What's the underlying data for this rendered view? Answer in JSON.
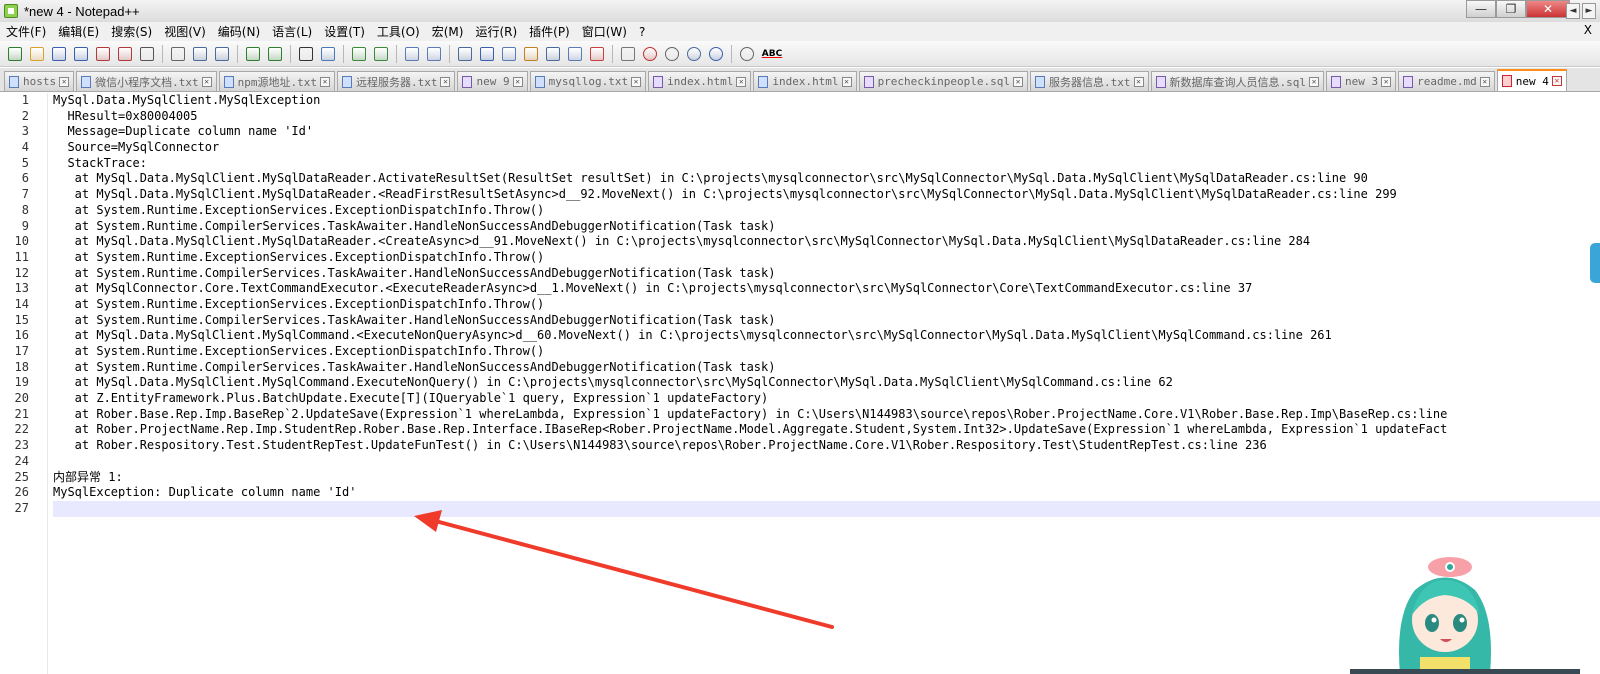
{
  "window": {
    "title": "*new 4 - Notepad++",
    "controls": [
      "—",
      "❐",
      "✕"
    ]
  },
  "menu": {
    "items": [
      "文件(F)",
      "编辑(E)",
      "搜索(S)",
      "视图(V)",
      "编码(N)",
      "语言(L)",
      "设置(T)",
      "工具(O)",
      "宏(M)",
      "运行(R)",
      "插件(P)",
      "窗口(W)",
      "?"
    ],
    "close_label": "X"
  },
  "toolbar": {
    "icons": [
      "new-file-icon",
      "open-file-icon",
      "save-icon",
      "save-all-icon",
      "close-icon",
      "close-all-icon",
      "print-icon",
      "cut-icon",
      "copy-icon",
      "paste-icon",
      "undo-icon",
      "redo-icon",
      "find-icon",
      "replace-icon",
      "zoom-in-icon",
      "zoom-out-icon",
      "sync-vertical-icon",
      "sync-horizontal-icon",
      "word-wrap-icon",
      "show-all-chars-icon",
      "indent-guide-icon",
      "language-icon",
      "doc-map-icon",
      "function-list-icon",
      "folder-workspace-icon",
      "monitor-icon",
      "record-macro-icon",
      "stop-macro-icon",
      "play-macro-icon",
      "run-macro-multiple-icon",
      "save-macro-icon",
      "spell-check-icon"
    ],
    "spell_label": "ABC"
  },
  "tabs": [
    {
      "label": "hosts",
      "color": "blue"
    },
    {
      "label": "微信小程序文档.txt",
      "color": "blue"
    },
    {
      "label": "npm源地址.txt",
      "color": "blue"
    },
    {
      "label": "远程服务器.txt",
      "color": "blue"
    },
    {
      "label": "new 9",
      "color": "purple"
    },
    {
      "label": "mysqllog.txt",
      "color": "blue"
    },
    {
      "label": "index.html",
      "color": "purple"
    },
    {
      "label": "index.html",
      "color": "blue"
    },
    {
      "label": "precheckinpeople.sql",
      "color": "purple"
    },
    {
      "label": "服务器信息.txt",
      "color": "blue"
    },
    {
      "label": "新数据库查询人员信息.sql",
      "color": "purple"
    },
    {
      "label": "new 3",
      "color": "purple"
    },
    {
      "label": "readme.md",
      "color": "purple"
    },
    {
      "label": "new 4",
      "color": "red",
      "active": true
    }
  ],
  "tab_nav": [
    "◄",
    "►"
  ],
  "editor": {
    "lines": [
      "MySql.Data.MySqlClient.MySqlException",
      "  HResult=0x80004005",
      "  Message=Duplicate column name 'Id'",
      "  Source=MySqlConnector",
      "  StackTrace:",
      "   at MySql.Data.MySqlClient.MySqlDataReader.ActivateResultSet(ResultSet resultSet) in C:\\projects\\mysqlconnector\\src\\MySqlConnector\\MySql.Data.MySqlClient\\MySqlDataReader.cs:line 90",
      "   at MySql.Data.MySqlClient.MySqlDataReader.<ReadFirstResultSetAsync>d__92.MoveNext() in C:\\projects\\mysqlconnector\\src\\MySqlConnector\\MySql.Data.MySqlClient\\MySqlDataReader.cs:line 299",
      "   at System.Runtime.ExceptionServices.ExceptionDispatchInfo.Throw()",
      "   at System.Runtime.CompilerServices.TaskAwaiter.HandleNonSuccessAndDebuggerNotification(Task task)",
      "   at MySql.Data.MySqlClient.MySqlDataReader.<CreateAsync>d__91.MoveNext() in C:\\projects\\mysqlconnector\\src\\MySqlConnector\\MySql.Data.MySqlClient\\MySqlDataReader.cs:line 284",
      "   at System.Runtime.ExceptionServices.ExceptionDispatchInfo.Throw()",
      "   at System.Runtime.CompilerServices.TaskAwaiter.HandleNonSuccessAndDebuggerNotification(Task task)",
      "   at MySqlConnector.Core.TextCommandExecutor.<ExecuteReaderAsync>d__1.MoveNext() in C:\\projects\\mysqlconnector\\src\\MySqlConnector\\Core\\TextCommandExecutor.cs:line 37",
      "   at System.Runtime.ExceptionServices.ExceptionDispatchInfo.Throw()",
      "   at System.Runtime.CompilerServices.TaskAwaiter.HandleNonSuccessAndDebuggerNotification(Task task)",
      "   at MySql.Data.MySqlClient.MySqlCommand.<ExecuteNonQueryAsync>d__60.MoveNext() in C:\\projects\\mysqlconnector\\src\\MySqlConnector\\MySql.Data.MySqlClient\\MySqlCommand.cs:line 261",
      "   at System.Runtime.ExceptionServices.ExceptionDispatchInfo.Throw()",
      "   at System.Runtime.CompilerServices.TaskAwaiter.HandleNonSuccessAndDebuggerNotification(Task task)",
      "   at MySql.Data.MySqlClient.MySqlCommand.ExecuteNonQuery() in C:\\projects\\mysqlconnector\\src\\MySqlConnector\\MySql.Data.MySqlClient\\MySqlCommand.cs:line 62",
      "   at Z.EntityFramework.Plus.BatchUpdate.Execute[T](IQueryable`1 query, Expression`1 updateFactory)",
      "   at Rober.Base.Rep.Imp.BaseRep`2.UpdateSave(Expression`1 whereLambda, Expression`1 updateFactory) in C:\\Users\\N144983\\source\\repos\\Rober.ProjectName.Core.V1\\Rober.Base.Rep.Imp\\BaseRep.cs:line",
      "   at Rober.ProjectName.Rep.Imp.StudentRep.Rober.Base.Rep.Interface.IBaseRep<Rober.ProjectName.Model.Aggregate.Student,System.Int32>.UpdateSave(Expression`1 whereLambda, Expression`1 updateFact",
      "   at Rober.Respository.Test.StudentRepTest.UpdateFunTest() in C:\\Users\\N144983\\source\\repos\\Rober.ProjectName.Core.V1\\Rober.Respository.Test\\StudentRepTest.cs:line 236",
      "",
      "内部异常 1:",
      "MySqlException: Duplicate column name 'Id'",
      ""
    ],
    "current_line": 27
  },
  "colors": {
    "annotation_arrow": "#f03a2a",
    "active_tab_accent": "#ff8c1a",
    "current_line_bg": "#e8e8ff"
  }
}
